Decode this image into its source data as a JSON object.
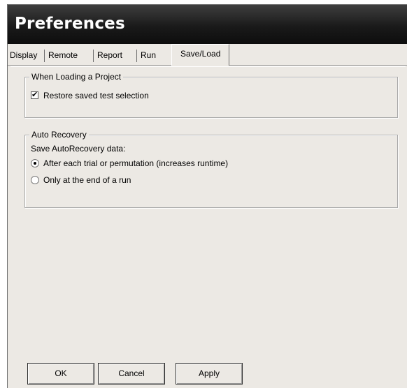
{
  "window": {
    "title": "Preferences"
  },
  "tabs": [
    {
      "label": "Display"
    },
    {
      "label": "Remote"
    },
    {
      "label": "Report"
    },
    {
      "label": "Run"
    },
    {
      "label": "Save/Load",
      "selected": true
    }
  ],
  "loading_group": {
    "legend": "When Loading a Project",
    "restore_selection": {
      "label": "Restore saved test selection",
      "checked": true
    }
  },
  "recovery_group": {
    "legend": "Auto Recovery",
    "save_label": "Save AutoRecovery data:",
    "options": [
      {
        "label": "After each trial or permutation (increases runtime)",
        "selected": true
      },
      {
        "label": "Only at the end of a run",
        "selected": false
      }
    ]
  },
  "buttons": {
    "ok": "OK",
    "cancel": "Cancel",
    "apply": "Apply"
  },
  "icons": {
    "check": "✔"
  }
}
